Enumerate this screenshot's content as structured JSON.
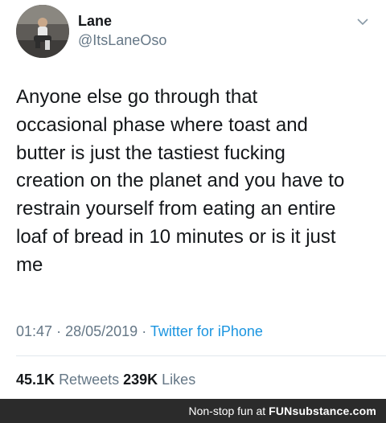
{
  "tweet": {
    "display_name": "Lane",
    "handle": "@ItsLaneOso",
    "text": "Anyone else go through that\noccasional phase where toast and\nbutter is just the tastiest fucking\ncreation on the planet and you have to\nrestrain yourself from eating an entire\nloaf of bread in 10 minutes or is it  just\nme",
    "time": "01:47",
    "date": "28/05/2019",
    "separator": "·",
    "source": "Twitter for iPhone",
    "retweets_count": "45.1K",
    "retweets_label": "Retweets",
    "likes_count": "239K",
    "likes_label": "Likes"
  },
  "watermark": {
    "prefix": "Non-stop fun at",
    "brand": "FUNsubstance.com"
  },
  "icons": {
    "menu": "chevron-down-icon",
    "avatar": "avatar"
  },
  "colors": {
    "text": "#14171a",
    "secondary": "#657786",
    "link": "#1b95e0",
    "footer_bg": "#2b2b2b"
  }
}
